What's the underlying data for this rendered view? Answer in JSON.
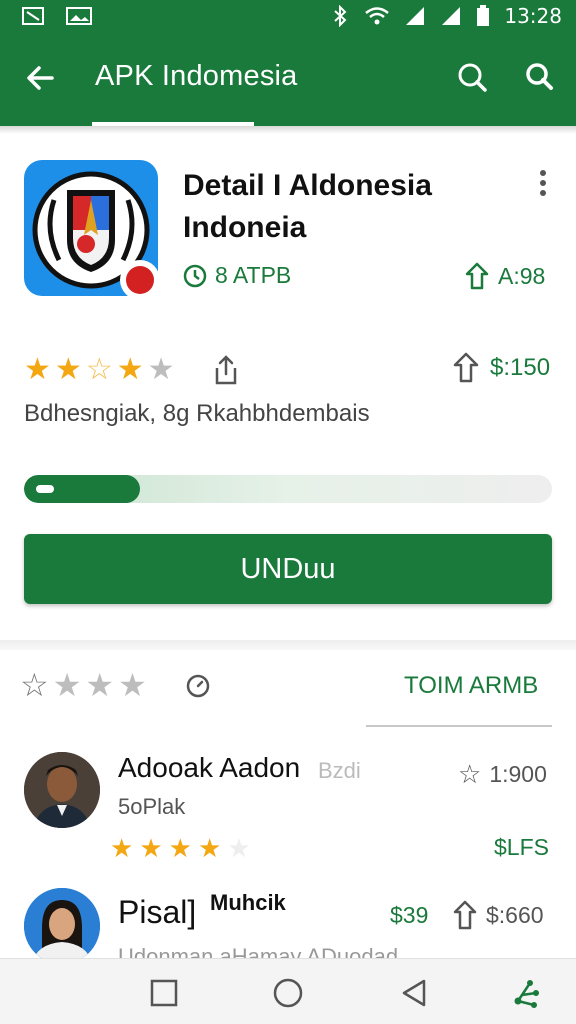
{
  "status_bar": {
    "time": "13:28",
    "icons": [
      "notification-icon",
      "image-icon",
      "bluetooth-icon",
      "wifi-icon",
      "signal-icon",
      "signal-icon",
      "battery-icon"
    ]
  },
  "app_bar": {
    "title": "APK Indomesia",
    "back_icon": "arrow-back-icon",
    "actions": [
      "search-icon",
      "search-icon"
    ]
  },
  "app": {
    "title": "Detail I Aldonesia Indoneia",
    "meta_left": "8 ATPB",
    "meta_right": "A:98",
    "rating_stars": [
      1,
      1,
      0.5,
      1,
      0
    ],
    "price": "$:150",
    "subtitle": "Bdhesngiak, 8g Rkahbhdembais",
    "download_progress": 0.22,
    "download_label": "UNDuu"
  },
  "reviews_header": {
    "stars": [
      0,
      1,
      1,
      1
    ],
    "link": "TOIM ARMB"
  },
  "reviews": [
    {
      "name": "Adooak Aadon",
      "name_extra": "Bzdi",
      "handle": "5oPlak",
      "stars": [
        1,
        1,
        1,
        1,
        0
      ],
      "count": "1:900",
      "tag": "$LFS"
    },
    {
      "name": "Pisal]",
      "name_extra": "Muhcik",
      "price_green": "$39",
      "price": "$:660",
      "text": "Udonman aHamay ADuodad"
    }
  ],
  "nav_bar": {
    "icons": [
      "square-icon",
      "circle-icon",
      "triangle-back-icon",
      "share-nodes-icon"
    ]
  },
  "colors": {
    "primary": "#1a7a3c",
    "star": "#f3a712",
    "icon_bg": "#1e8fe8"
  }
}
